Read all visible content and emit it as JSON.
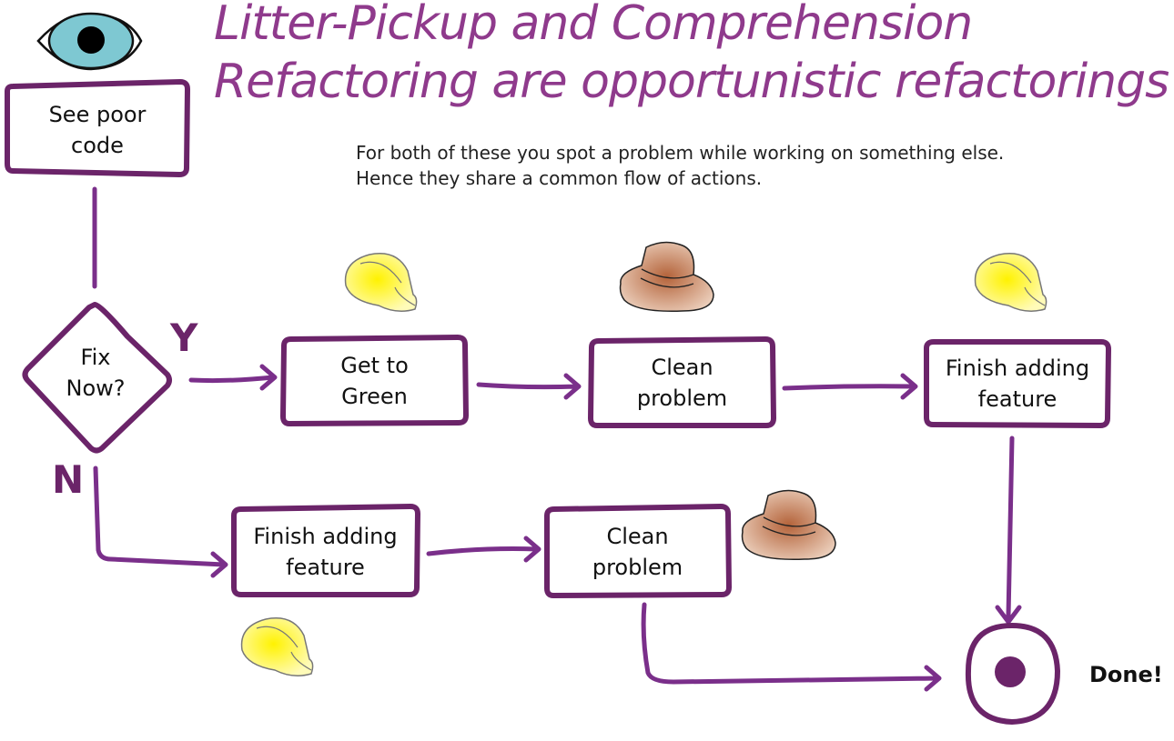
{
  "title": {
    "line1": "Litter-Pickup and Comprehension",
    "line2": "Refactoring are opportunistic refactorings"
  },
  "subtitle": {
    "line1": "For both of these you spot a problem while working on something else.",
    "line2": "Hence they share a common flow of actions."
  },
  "colors": {
    "accent": "#6b2469",
    "title": "#8f3a8c",
    "arrow": "#7a2f8a",
    "eye_iris": "#7ec8d2",
    "hardhat": "#fff56a",
    "fedora": "#b87a5a"
  },
  "nodes": {
    "start": {
      "label": "See poor\ncode",
      "icon": "eye-icon"
    },
    "decision": {
      "label": "Fix\nNow?"
    },
    "yes_label": "Y",
    "no_label": "N",
    "get_green": {
      "label": "Get to\nGreen",
      "icon": "hardhat-icon"
    },
    "clean_top": {
      "label": "Clean\nproblem",
      "icon": "fedora-icon"
    },
    "finish_top": {
      "label": "Finish adding\nfeature",
      "icon": "hardhat-icon"
    },
    "finish_bottom": {
      "label": "Finish adding\nfeature",
      "icon": "hardhat-icon"
    },
    "clean_bottom": {
      "label": "Clean\nproblem",
      "icon": "fedora-icon"
    },
    "end": {
      "label": "Done!"
    }
  }
}
